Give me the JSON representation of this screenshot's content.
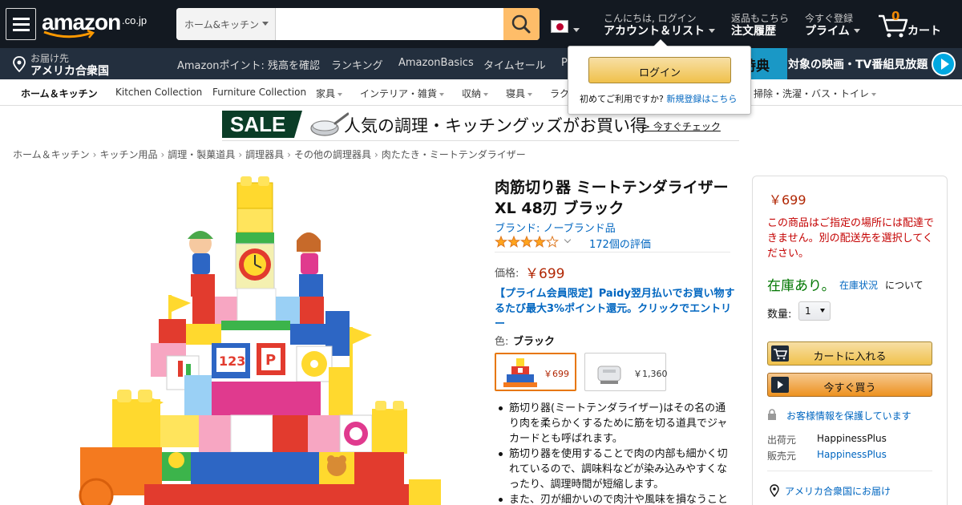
{
  "header": {
    "logo_text": "amazon",
    "logo_suffix": ".co.jp",
    "search_category": "ホーム&キッチン",
    "search_placeholder": "",
    "account_greeting": "こんにちは, ログイン",
    "account_label": "アカウント＆リスト",
    "orders_line1": "返品もこちら",
    "orders_line2": "注文履歴",
    "prime_line1": "今すぐ登録",
    "prime_line2": "プライム",
    "cart_count": "0",
    "cart_label": "カート"
  },
  "subnav": {
    "deliver_line1": "お届け先",
    "deliver_line2": "アメリカ合衆国",
    "links": [
      "Amazonポイント: 残高を確認",
      "ランキング",
      "AmazonBasics",
      "タイムセール",
      "P"
    ],
    "prime_badge": "特典",
    "prime_banner_text": "対象の映画・TV番組見放題"
  },
  "category_bar": {
    "items": [
      {
        "label": "ホーム＆キッチン",
        "dropdown": false
      },
      {
        "label": "Kitchen Collection",
        "dropdown": false
      },
      {
        "label": "Furniture Collection",
        "dropdown": false
      },
      {
        "label": "家具",
        "dropdown": true
      },
      {
        "label": "インテリア・雑貨",
        "dropdown": true
      },
      {
        "label": "収納",
        "dropdown": true
      },
      {
        "label": "寝具",
        "dropdown": true
      },
      {
        "label": "ラク",
        "dropdown": false
      },
      {
        "label": "掃除・洗濯・バス・トイレ",
        "dropdown": true
      }
    ]
  },
  "popover": {
    "login_label": "ログイン",
    "new_user_text": "初めてご利用ですか?",
    "new_user_link": "新規登録はこちら"
  },
  "sale_banner": {
    "tag": "SALE",
    "text": "人気の調理・キッチングッズがお買い得",
    "link": "> 今すぐチェック"
  },
  "breadcrumb": [
    "ホーム＆キッチン",
    "キッチン用品",
    "調理・製菓道具",
    "調理器具",
    "その他の調理器具",
    "肉たたき・ミートテンダライザー"
  ],
  "product": {
    "title": "肉筋切り器 ミートテンダライザー XL 48刃 ブラック",
    "brand": "ブランド: ノーブランド品",
    "rating": 4,
    "rating_max": 5,
    "ratings_count": "172個の評価",
    "price_label": "価格:",
    "price": "￥699",
    "prime_promo": "【プライム会員限定】Paidy翌月払いでお買い物するたび最大3%ポイント還元。クリックでエントリー",
    "color_label": "色:",
    "color_value": "ブラック",
    "swatches": [
      {
        "price": "￥699",
        "selected": true
      },
      {
        "price": "￥1,360",
        "selected": false
      }
    ],
    "bullets": [
      "筋切り器(ミートテンダライザー)はその名の通り肉を柔らかくするために筋を切る道具でジャカードとも呼ばれます。",
      "筋切り器を使用することで肉の内部も細かく切れているので、調味料などが染み込みやすくなったり、調理時間が短縮します。",
      "また、刃が細かいので肉汁や風味を損なうこと"
    ]
  },
  "buybox": {
    "price": "￥699",
    "warning": "この商品はご指定の場所には配達できません。別の配送先を選択してください。",
    "stock": "在庫あり。",
    "stock_link": "在庫状況",
    "stock_suffix": "について",
    "qty_label": "数量:",
    "qty_value": "1",
    "add_to_cart": "カートに入れる",
    "buy_now": "今すぐ買う",
    "secure": "お客様情報を保護しています",
    "ships_from_label": "出荷元",
    "ships_from": "HappinessPlus",
    "sold_by_label": "販売元",
    "sold_by": "HappinessPlus",
    "deliver_to": "アメリカ合衆国にお届け"
  },
  "colors": {
    "nav_dark": "#131921",
    "nav_sub": "#232f3e",
    "search_button": "#febd69",
    "price_red": "#b12704",
    "link_blue": "#0066c0",
    "stock_green": "#007600",
    "cart_orange": "#f08804"
  }
}
